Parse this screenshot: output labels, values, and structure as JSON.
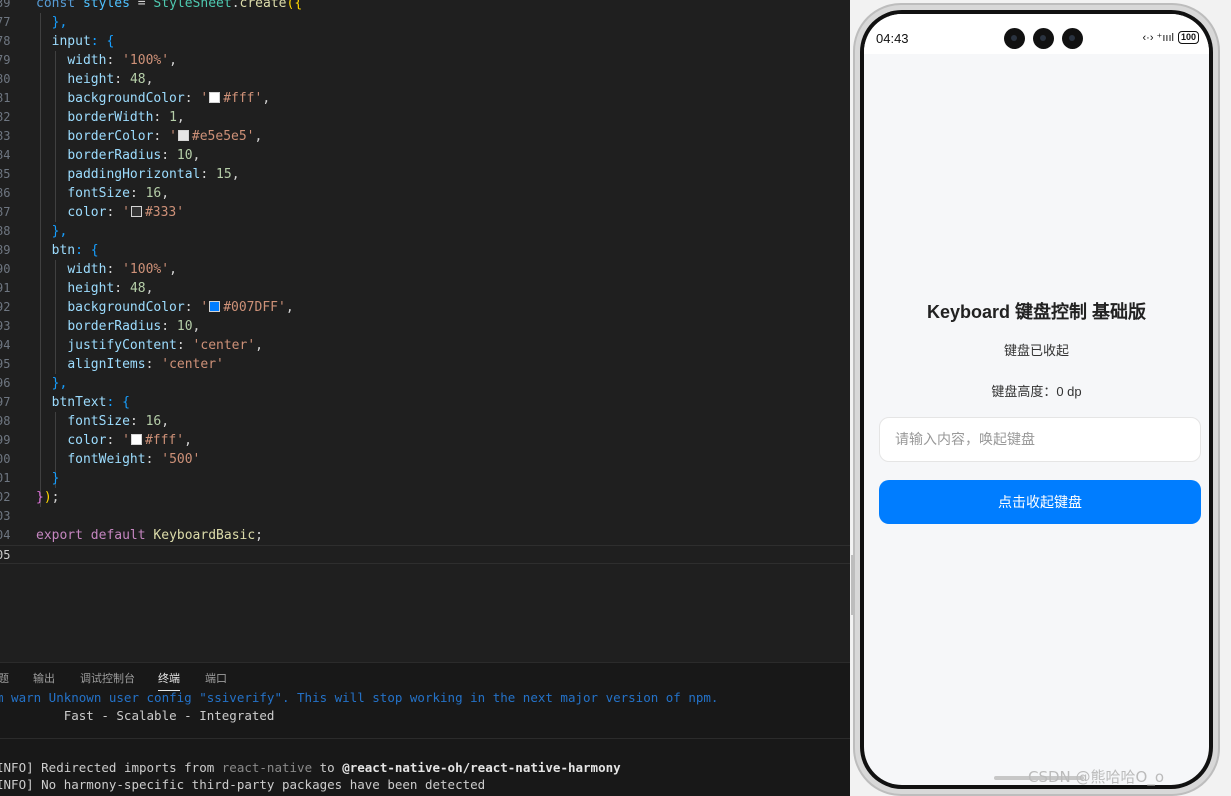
{
  "editor": {
    "line_numbers": [
      "39",
      "77",
      "78",
      "79",
      "80",
      "81",
      "82",
      "83",
      "84",
      "85",
      "86",
      "87",
      "88",
      "89",
      "90",
      "91",
      "92",
      "93",
      "94",
      "95",
      "96",
      "97",
      "98",
      "99",
      "100",
      "101",
      "102",
      "103",
      "104",
      "105"
    ],
    "code_tokens": {
      "l0": [
        "const ",
        "styles",
        " = ",
        "StyleSheet",
        ".",
        "create",
        "({"
      ],
      "l1": "},",
      "l2": [
        "input",
        ": {"
      ],
      "l3": [
        "width",
        ": ",
        "'100%'",
        ","
      ],
      "l4": [
        "height",
        ": ",
        "48",
        ","
      ],
      "l5": [
        "backgroundColor",
        ": ",
        "'",
        "#fff'",
        ","
      ],
      "l6": [
        "borderWidth",
        ": ",
        "1",
        ","
      ],
      "l7": [
        "borderColor",
        ": ",
        "'",
        "#e5e5e5'",
        ","
      ],
      "l8": [
        "borderRadius",
        ": ",
        "10",
        ","
      ],
      "l9": [
        "paddingHorizontal",
        ": ",
        "15",
        ","
      ],
      "l10": [
        "fontSize",
        ": ",
        "16",
        ","
      ],
      "l11": [
        "color",
        ": ",
        "'",
        "#333'"
      ],
      "l12": "},",
      "l13": [
        "btn",
        ": {"
      ],
      "l14": [
        "width",
        ": ",
        "'100%'",
        ","
      ],
      "l15": [
        "height",
        ": ",
        "48",
        ","
      ],
      "l16": [
        "backgroundColor",
        ": ",
        "'",
        "#007DFF'",
        ","
      ],
      "l17": [
        "borderRadius",
        ": ",
        "10",
        ","
      ],
      "l18": [
        "justifyContent",
        ": ",
        "'center'",
        ","
      ],
      "l19": [
        "alignItems",
        ": ",
        "'center'"
      ],
      "l20": "},",
      "l21": [
        "btnText",
        ": {"
      ],
      "l22": [
        "fontSize",
        ": ",
        "16",
        ","
      ],
      "l23": [
        "color",
        ": ",
        "'",
        "#fff'",
        ","
      ],
      "l24": [
        "fontWeight",
        ": ",
        "'500'"
      ],
      "l25": "}",
      "l26": "});",
      "l28": [
        "export",
        " ",
        "default",
        " ",
        "KeyboardBasic",
        ";"
      ]
    },
    "swatch_colors": {
      "fff": "#ffffff",
      "e5e5e5": "#e5e5e5",
      "333": "#333333",
      "007DFF": "#007DFF"
    }
  },
  "panel": {
    "tabs": [
      "题",
      "输出",
      "调试控制台",
      "终端",
      "端口"
    ],
    "active_tab": "终端",
    "terminal": {
      "warn": "m warn Unknown user config \"ssiverify\". This will stop working in the next major version of npm.",
      "tagline": "         Fast - Scalable - Integrated",
      "info1_prefix": "INFO] ",
      "info1_a": "Redirected imports from ",
      "info1_b": "react-native",
      "info1_c": " to ",
      "info1_d": "@react-native-oh/react-native-harmony",
      "info2": "INFO] No harmony-specific third-party packages have been detected"
    }
  },
  "phone": {
    "time": "04:43",
    "status_icons": "‹·› ⁺ıııl",
    "battery": "100",
    "title": "Keyboard 键盘控制 基础版",
    "keyboard_state": "键盘已收起",
    "keyboard_height": "键盘高度：0 dp",
    "input_placeholder": "请输入内容，唤起键盘",
    "button_label": "点击收起键盘",
    "accent_color": "#007DFF"
  },
  "watermark": "CSDN @熊哈哈O_o"
}
